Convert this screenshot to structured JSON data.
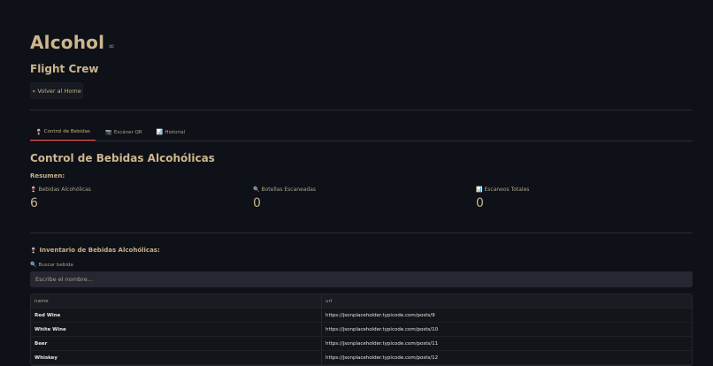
{
  "header": {
    "title": "Alcohol",
    "subtitle": "Flight Crew",
    "back_button": "« Volver al Home"
  },
  "tabs": [
    {
      "icon": "🍷",
      "label": "Control de Bebidas"
    },
    {
      "icon": "📷",
      "label": "Escáner QR"
    },
    {
      "icon": "📊",
      "label": "Historial"
    }
  ],
  "main": {
    "section_title": "Control de Bebidas Alcohólicas",
    "summary_label": "Resumen:",
    "metrics": [
      {
        "icon": "🍷",
        "label": "Bebidas Alcohólicas",
        "value": "6"
      },
      {
        "icon": "🔍",
        "label": "Botellas Escaneadas",
        "value": "0"
      },
      {
        "icon": "📊",
        "label": "Escaneos Totales",
        "value": "0"
      }
    ],
    "inventory_title": "Inventario de Bebidas Alcohólicas:",
    "inventory_icon": "🍷",
    "search": {
      "icon": "🔍",
      "label": "Buscar bebida",
      "placeholder": "Escribe el nombre...",
      "value": ""
    },
    "table": {
      "columns": [
        "name",
        "url"
      ],
      "rows": [
        [
          "Red Wine",
          "https://jsonplaceholder.typicode.com/posts/9"
        ],
        [
          "White Wine",
          "https://jsonplaceholder.typicode.com/posts/10"
        ],
        [
          "Beer",
          "https://jsonplaceholder.typicode.com/posts/11"
        ],
        [
          "Whiskey",
          "https://jsonplaceholder.typicode.com/posts/12"
        ]
      ]
    }
  },
  "colors": {
    "background": "#0e1117",
    "text": "#c9b28a",
    "accent": "#ff4b4b",
    "input_bg": "#262730"
  }
}
